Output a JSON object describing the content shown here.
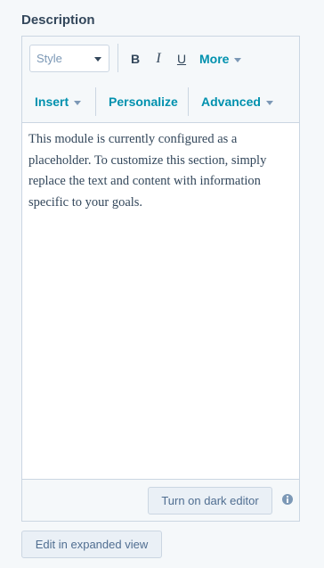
{
  "field": {
    "label": "Description"
  },
  "toolbar": {
    "style_select": {
      "value": "Style"
    },
    "bold_label": "B",
    "italic_label": "I",
    "underline_label": "U",
    "more_label": "More",
    "insert_label": "Insert",
    "personalize_label": "Personalize",
    "advanced_label": "Advanced"
  },
  "editor": {
    "content": "This module is currently configured as a placeholder. To customize this section, simply replace the text and content with information specific to your goals."
  },
  "footer": {
    "dark_editor_label": "Turn on dark editor"
  },
  "actions": {
    "expand_label": "Edit in expanded view"
  },
  "colors": {
    "accent": "#0091ae",
    "text": "#33475b",
    "border": "#cbd6e2",
    "background": "#f5f8fa"
  },
  "icons": {
    "info": "info-icon",
    "dropdown": "caret-down-icon"
  }
}
